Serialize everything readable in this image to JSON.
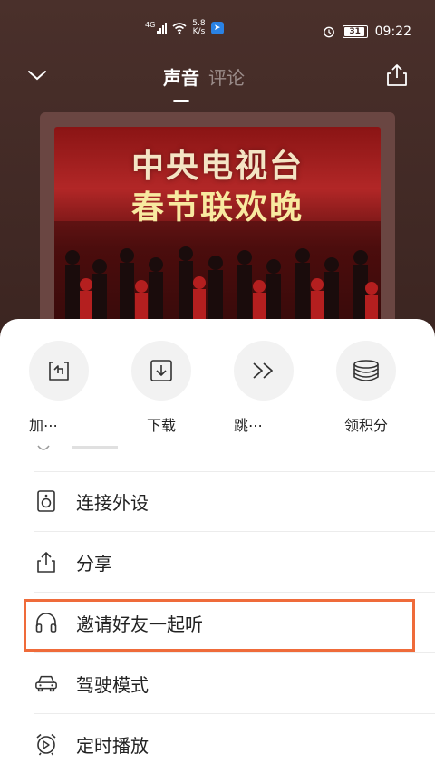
{
  "status_bar": {
    "network": "4G",
    "speed_value": "5.8",
    "speed_unit": "K/s",
    "battery": "31",
    "time": "09:22"
  },
  "nav": {
    "tabs": [
      {
        "label": "声音",
        "active": true
      },
      {
        "label": "评论",
        "active": false
      }
    ]
  },
  "album": {
    "title": "中央电视台",
    "subtitle": "春节联欢晚"
  },
  "actions": [
    {
      "label": "加⋯",
      "icon": "add-to-playlist-icon"
    },
    {
      "label": "下载",
      "icon": "download-icon"
    },
    {
      "label": "跳⋯",
      "icon": "skip-icon"
    },
    {
      "label": "领积分",
      "icon": "points-coins-icon"
    }
  ],
  "menu": [
    {
      "label": "连接外设",
      "icon": "speaker-icon"
    },
    {
      "label": "分享",
      "icon": "share-icon"
    },
    {
      "label": "邀请好友一起听",
      "icon": "headphones-icon"
    },
    {
      "label": "驾驶模式",
      "icon": "car-icon"
    },
    {
      "label": "定时播放",
      "icon": "alarm-clock-icon"
    }
  ],
  "colors": {
    "highlight": "#ef6b3a",
    "sheet_bg": "#ffffff",
    "background": "#3d2622"
  }
}
